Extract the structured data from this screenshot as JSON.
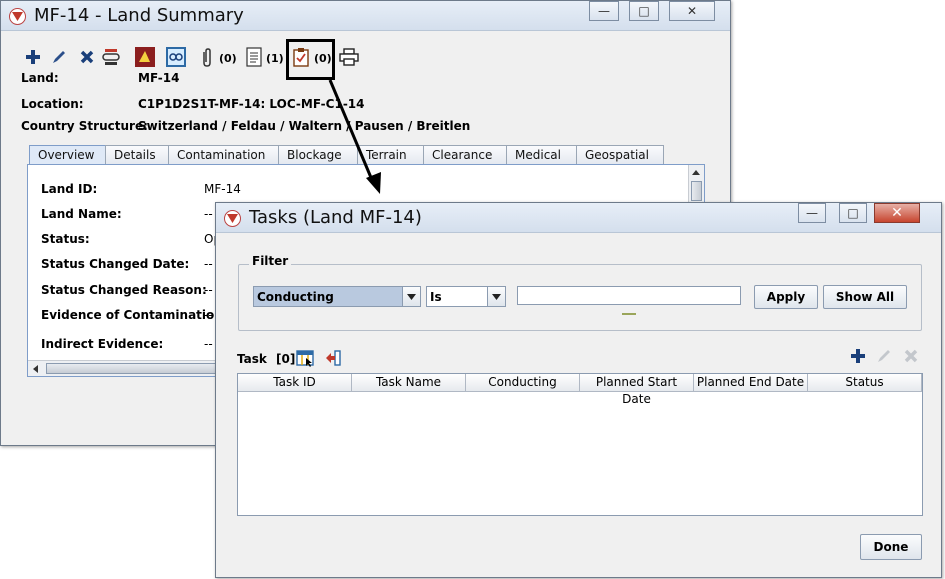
{
  "land_window": {
    "title": "MF-14 - Land Summary",
    "toolbar": {
      "attachments_count": "(0)",
      "documents_count": "(1)",
      "tasks_count": "(0)"
    },
    "land_label": "Land:",
    "land_value": "MF-14",
    "location_label": "Location:",
    "location_value": "C1P1D2S1T-MF-14: LOC-MF-C1-14",
    "country_label": "Country Structure:",
    "country_value": "Switzerland / Feldau / Waltern / Pausen / Breitlen",
    "tabs": [
      "Overview",
      "Details",
      "Contamination",
      "Blockage",
      "Terrain",
      "Clearance",
      "Medical",
      "Geospatial"
    ],
    "overview": {
      "fields": [
        {
          "label": "Land ID:",
          "value": "MF-14"
        },
        {
          "label": "Land Name:",
          "value": "--"
        },
        {
          "label": "Status:",
          "value": "Op"
        },
        {
          "label": "Status Changed Date:",
          "value": "--"
        },
        {
          "label": "Status Changed Reason:",
          "value": "--"
        },
        {
          "label": "Evidence of Contamination:",
          "value": "--"
        },
        {
          "label": "Indirect Evidence:",
          "value": "--"
        }
      ]
    }
  },
  "tasks_window": {
    "title": "Tasks (Land MF-14)",
    "filter_label": "Filter",
    "field_select": "Conducting",
    "operator_select": "Is",
    "filter_value": "",
    "apply_label": "Apply",
    "show_all_label": "Show All",
    "task_label": "Task",
    "task_count": "[0]",
    "columns": [
      "Task ID",
      "Task Name",
      "Conducting",
      "Planned Start Date",
      "Planned End Date",
      "Status"
    ],
    "done_label": "Done"
  },
  "colors": {
    "highlight_box": "#000000",
    "combo_selected": "#b9c9df",
    "tab_active": "#dfe9f7"
  }
}
